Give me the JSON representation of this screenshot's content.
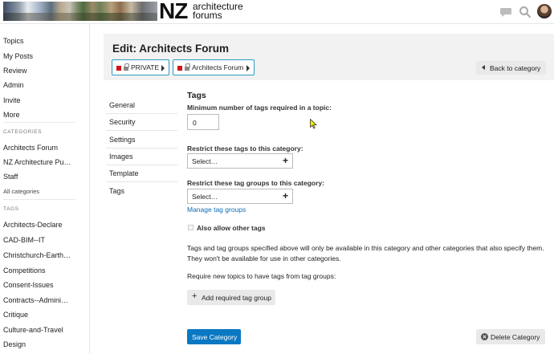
{
  "header": {
    "logo_mark": "NZ",
    "logo_line1": "architecture",
    "logo_line2": "forums",
    "icons": [
      "chat-icon",
      "search-icon",
      "avatar"
    ]
  },
  "sidebar": {
    "nav": [
      "Topics",
      "My Posts",
      "Review",
      "Admin",
      "Invite",
      "More"
    ],
    "categories_heading": "CATEGORIES",
    "categories": [
      "Architects Forum",
      "NZ Architecture Pu…",
      "Staff"
    ],
    "all_categories": "All categories",
    "tags_heading": "TAGS",
    "tags": [
      "Architects-Declare",
      "CAD-BIM--IT",
      "Christchurch-Earth…",
      "Competitions",
      "Consent-Issues",
      "Contracts--Admini…",
      "Critique",
      "Culture-and-Travel",
      "Design"
    ]
  },
  "edit": {
    "title": "Edit: Architects Forum",
    "breadcrumbs": [
      "PRIVATE",
      "Architects Forum"
    ],
    "back_label": "Back to category",
    "accent_color": "#d4121b"
  },
  "settings_nav": [
    "General",
    "Security",
    "Settings",
    "Images",
    "Template",
    "Tags"
  ],
  "tags_panel": {
    "title": "Tags",
    "min_tags_label": "Minimum number of tags required in a topic:",
    "min_tags_value": "0",
    "restrict_tags_label": "Restrict these tags to this category:",
    "restrict_tags_placeholder": "Select…",
    "restrict_groups_label": "Restrict these tag groups to this category:",
    "restrict_groups_placeholder": "Select…",
    "manage_link": "Manage tag groups",
    "allow_other_label": "Also allow other tags",
    "allow_other_checked": false,
    "description": "Tags and tag groups specified above will only be available in this category and other categories that also specify them. They won't be available for use in other categories.",
    "require_label": "Require new topics to have tags from tag groups:",
    "add_group_label": "Add required tag group",
    "save_label": "Save Category",
    "delete_label": "Delete Category"
  }
}
